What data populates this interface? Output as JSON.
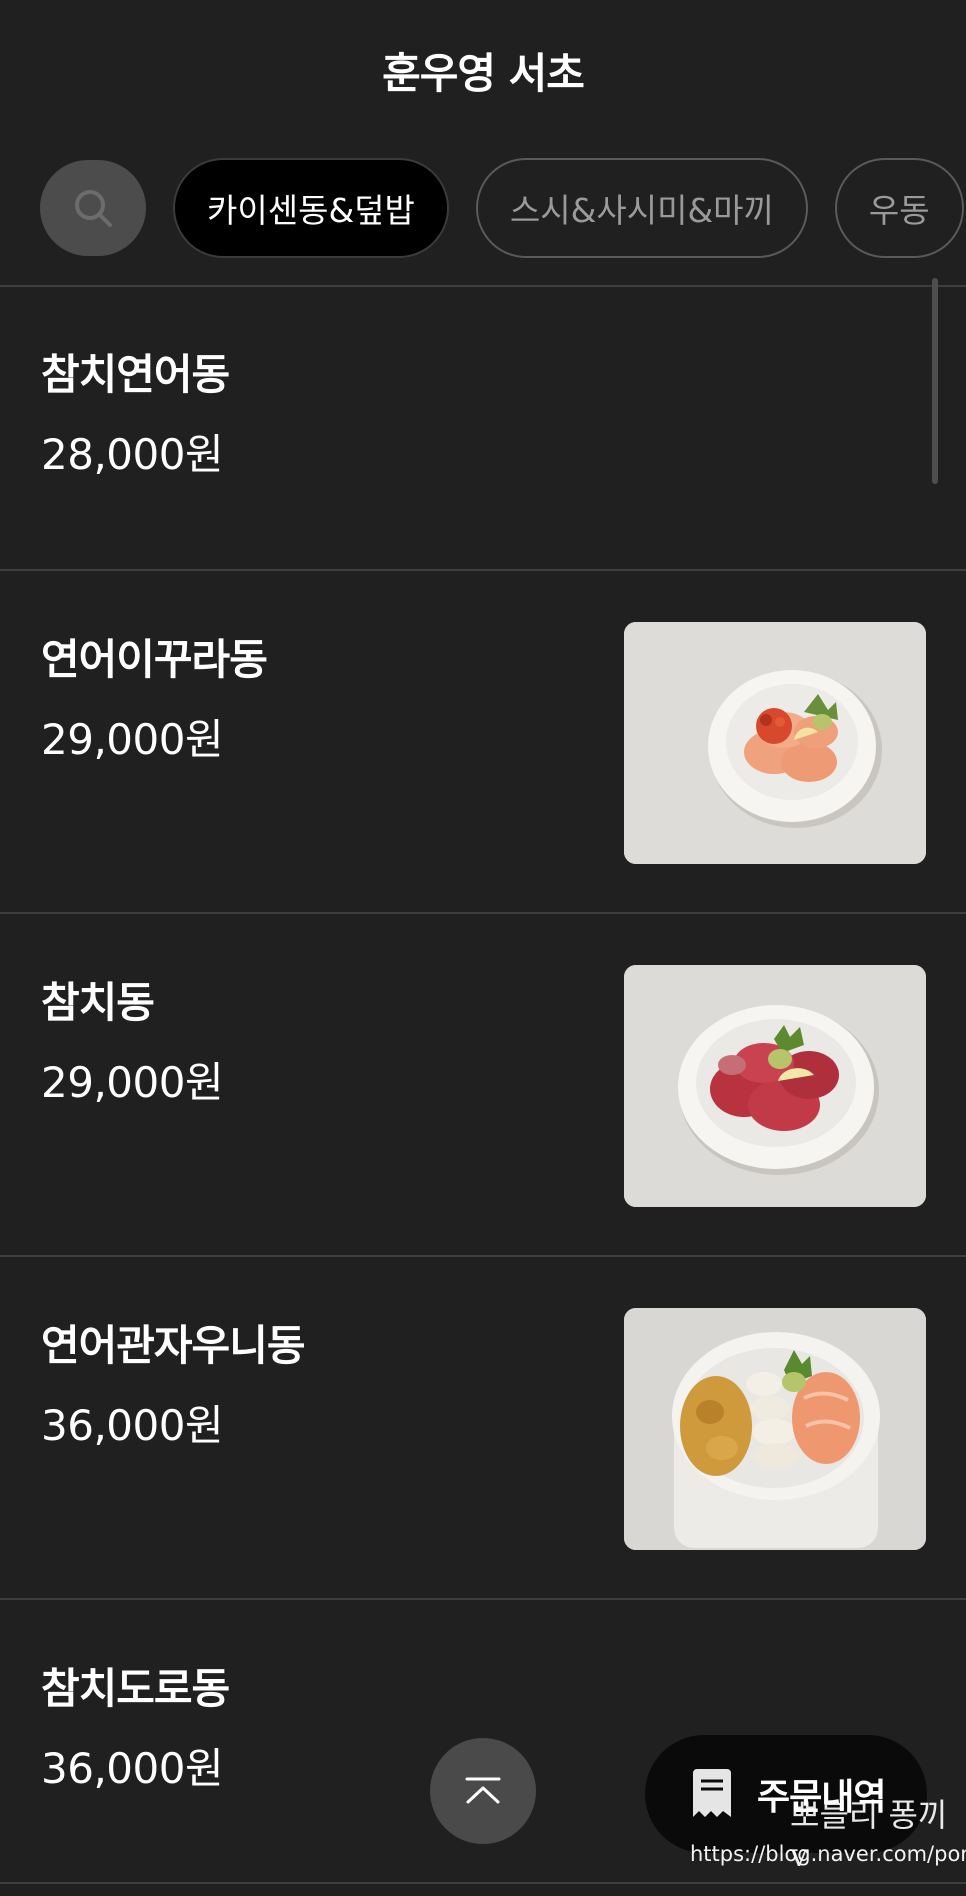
{
  "header": {
    "title": "훈우영 서초"
  },
  "tabs": [
    {
      "label": "카이센동&덮밥",
      "active": true
    },
    {
      "label": "스시&사시미&마끼",
      "active": false
    },
    {
      "label": "우동",
      "active": false
    }
  ],
  "icons": {
    "search": "search-icon",
    "scroll_top": "scroll-top-icon",
    "receipt": "receipt-icon"
  },
  "menu": [
    {
      "name": "참치연어동",
      "price": "28,000원",
      "has_image": false
    },
    {
      "name": "연어이꾸라동",
      "price": "29,000원",
      "has_image": true,
      "image": "salmon-ikura-bowl"
    },
    {
      "name": "참치동",
      "price": "29,000원",
      "has_image": true,
      "image": "tuna-bowl"
    },
    {
      "name": "연어관자우니동",
      "price": "36,000원",
      "has_image": true,
      "image": "salmon-scallop-uni-bowl"
    },
    {
      "name": "참치도로동",
      "price": "36,000원",
      "has_image": false
    }
  ],
  "floating": {
    "order_label": "주문내역"
  },
  "watermark": {
    "name": "뽀블리 퐁끼v",
    "url": "https://blog.naver.com/pongkki"
  },
  "colors": {
    "background": "#202021",
    "divider": "#3e3e3f",
    "active_tab": "#000000"
  }
}
